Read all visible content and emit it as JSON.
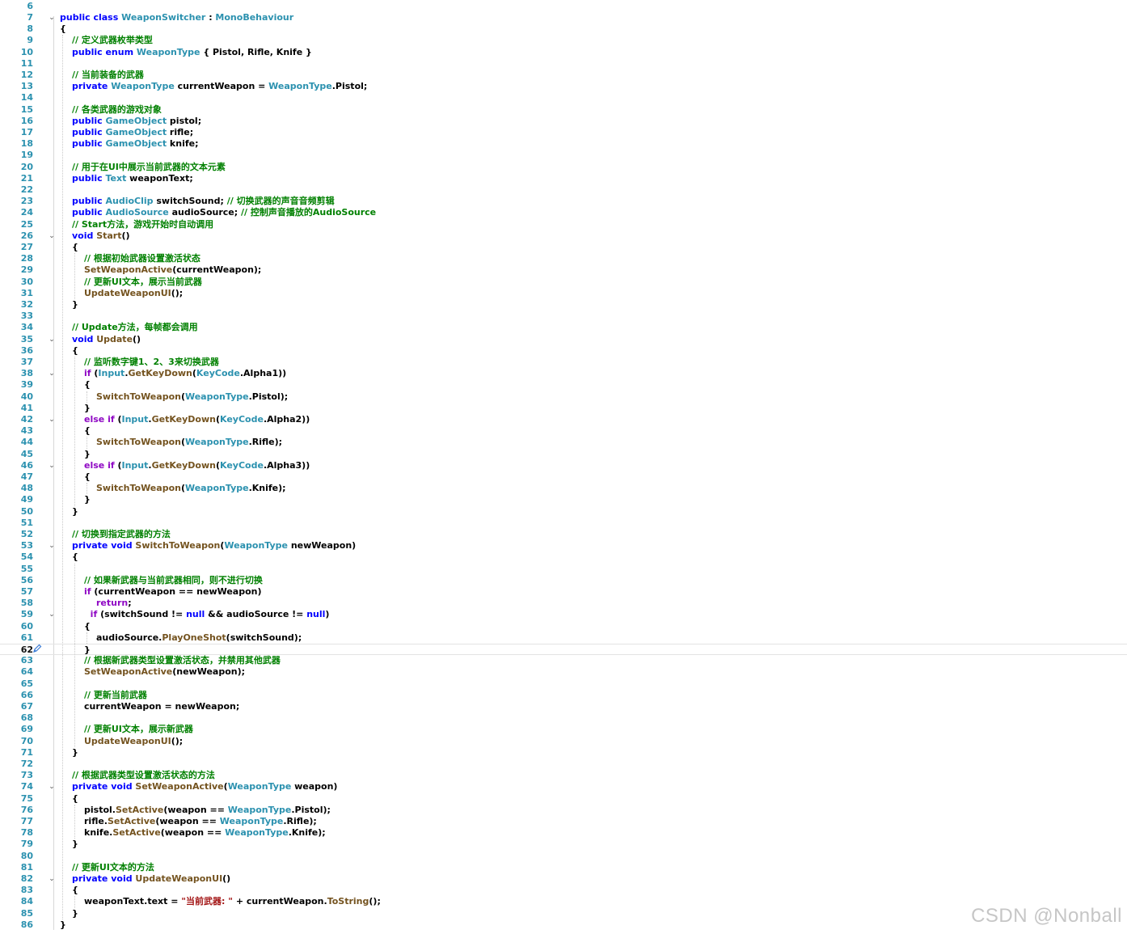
{
  "editor": {
    "first_line_number": 6,
    "current_line_number": 62,
    "lines": [
      {
        "n": 6,
        "tokens": []
      },
      {
        "n": 7,
        "fold": true,
        "tokens": [
          [
            "keyword",
            "public class "
          ],
          [
            "type",
            "WeaponSwitcher"
          ],
          [
            "plain",
            " : "
          ],
          [
            "type",
            "MonoBehaviour"
          ]
        ]
      },
      {
        "n": 8,
        "tokens": [
          [
            "plain",
            "{"
          ]
        ]
      },
      {
        "n": 9,
        "indent": 1,
        "tokens": [
          [
            "comment",
            "// 定义武器枚举类型"
          ]
        ]
      },
      {
        "n": 10,
        "indent": 1,
        "tokens": [
          [
            "keyword",
            "public enum "
          ],
          [
            "type",
            "WeaponType"
          ],
          [
            "plain",
            " { Pistol, Rifle, Knife }"
          ]
        ]
      },
      {
        "n": 11,
        "tokens": []
      },
      {
        "n": 12,
        "indent": 1,
        "tokens": [
          [
            "comment",
            "// 当前装备的武器"
          ]
        ]
      },
      {
        "n": 13,
        "indent": 1,
        "tokens": [
          [
            "keyword",
            "private "
          ],
          [
            "type",
            "WeaponType"
          ],
          [
            "plain",
            " currentWeapon = "
          ],
          [
            "type",
            "WeaponType"
          ],
          [
            "plain",
            ".Pistol;"
          ]
        ]
      },
      {
        "n": 14,
        "tokens": []
      },
      {
        "n": 15,
        "indent": 1,
        "tokens": [
          [
            "comment",
            "// 各类武器的游戏对象"
          ]
        ]
      },
      {
        "n": 16,
        "indent": 1,
        "tokens": [
          [
            "keyword",
            "public "
          ],
          [
            "type",
            "GameObject"
          ],
          [
            "plain",
            " pistol;"
          ]
        ]
      },
      {
        "n": 17,
        "indent": 1,
        "tokens": [
          [
            "keyword",
            "public "
          ],
          [
            "type",
            "GameObject"
          ],
          [
            "plain",
            " rifle;"
          ]
        ]
      },
      {
        "n": 18,
        "indent": 1,
        "tokens": [
          [
            "keyword",
            "public "
          ],
          [
            "type",
            "GameObject"
          ],
          [
            "plain",
            " knife;"
          ]
        ]
      },
      {
        "n": 19,
        "tokens": []
      },
      {
        "n": 20,
        "indent": 1,
        "tokens": [
          [
            "comment",
            "// 用于在UI中展示当前武器的文本元素"
          ]
        ]
      },
      {
        "n": 21,
        "indent": 1,
        "tokens": [
          [
            "keyword",
            "public "
          ],
          [
            "type",
            "Text"
          ],
          [
            "plain",
            " weaponText;"
          ]
        ]
      },
      {
        "n": 22,
        "tokens": []
      },
      {
        "n": 23,
        "indent": 1,
        "tokens": [
          [
            "keyword",
            "public "
          ],
          [
            "type",
            "AudioClip"
          ],
          [
            "plain",
            " switchSound; "
          ],
          [
            "comment",
            "// 切换武器的声音音频剪辑"
          ]
        ]
      },
      {
        "n": 24,
        "indent": 1,
        "tokens": [
          [
            "keyword",
            "public "
          ],
          [
            "type",
            "AudioSource"
          ],
          [
            "plain",
            " audioSource; "
          ],
          [
            "comment",
            "// 控制声音播放的AudioSource"
          ]
        ]
      },
      {
        "n": 25,
        "indent": 1,
        "tokens": [
          [
            "comment",
            "// Start方法，游戏开始时自动调用"
          ]
        ]
      },
      {
        "n": 26,
        "indent": 1,
        "fold": true,
        "tokens": [
          [
            "keyword",
            "void "
          ],
          [
            "method",
            "Start"
          ],
          [
            "plain",
            "()"
          ]
        ]
      },
      {
        "n": 27,
        "indent": 1,
        "tokens": [
          [
            "plain",
            "{"
          ]
        ]
      },
      {
        "n": 28,
        "indent": 2,
        "tokens": [
          [
            "comment",
            "// 根据初始武器设置激活状态"
          ]
        ]
      },
      {
        "n": 29,
        "indent": 2,
        "tokens": [
          [
            "method",
            "SetWeaponActive"
          ],
          [
            "plain",
            "(currentWeapon);"
          ]
        ]
      },
      {
        "n": 30,
        "indent": 2,
        "tokens": [
          [
            "comment",
            "// 更新UI文本，展示当前武器"
          ]
        ]
      },
      {
        "n": 31,
        "indent": 2,
        "tokens": [
          [
            "method",
            "UpdateWeaponUI"
          ],
          [
            "plain",
            "();"
          ]
        ]
      },
      {
        "n": 32,
        "indent": 1,
        "tokens": [
          [
            "plain",
            "}"
          ]
        ]
      },
      {
        "n": 33,
        "tokens": []
      },
      {
        "n": 34,
        "indent": 1,
        "tokens": [
          [
            "comment",
            "// Update方法，每帧都会调用"
          ]
        ]
      },
      {
        "n": 35,
        "indent": 1,
        "fold": true,
        "tokens": [
          [
            "keyword",
            "void "
          ],
          [
            "method",
            "Update"
          ],
          [
            "plain",
            "()"
          ]
        ]
      },
      {
        "n": 36,
        "indent": 1,
        "tokens": [
          [
            "plain",
            "{"
          ]
        ]
      },
      {
        "n": 37,
        "indent": 2,
        "tokens": [
          [
            "comment",
            "// 监听数字键1、2、3来切换武器"
          ]
        ]
      },
      {
        "n": 38,
        "indent": 2,
        "fold": true,
        "tokens": [
          [
            "control",
            "if "
          ],
          [
            "plain",
            "("
          ],
          [
            "type",
            "Input"
          ],
          [
            "plain",
            "."
          ],
          [
            "method",
            "GetKeyDown"
          ],
          [
            "plain",
            "("
          ],
          [
            "type",
            "KeyCode"
          ],
          [
            "plain",
            ".Alpha1))"
          ]
        ]
      },
      {
        "n": 39,
        "indent": 2,
        "tokens": [
          [
            "plain",
            "{"
          ]
        ]
      },
      {
        "n": 40,
        "indent": 3,
        "tokens": [
          [
            "method",
            "SwitchToWeapon"
          ],
          [
            "plain",
            "("
          ],
          [
            "type",
            "WeaponType"
          ],
          [
            "plain",
            ".Pistol);"
          ]
        ]
      },
      {
        "n": 41,
        "indent": 2,
        "tokens": [
          [
            "plain",
            "}"
          ]
        ]
      },
      {
        "n": 42,
        "indent": 2,
        "fold": true,
        "tokens": [
          [
            "control",
            "else if "
          ],
          [
            "plain",
            "("
          ],
          [
            "type",
            "Input"
          ],
          [
            "plain",
            "."
          ],
          [
            "method",
            "GetKeyDown"
          ],
          [
            "plain",
            "("
          ],
          [
            "type",
            "KeyCode"
          ],
          [
            "plain",
            ".Alpha2))"
          ]
        ]
      },
      {
        "n": 43,
        "indent": 2,
        "tokens": [
          [
            "plain",
            "{"
          ]
        ]
      },
      {
        "n": 44,
        "indent": 3,
        "tokens": [
          [
            "method",
            "SwitchToWeapon"
          ],
          [
            "plain",
            "("
          ],
          [
            "type",
            "WeaponType"
          ],
          [
            "plain",
            ".Rifle);"
          ]
        ]
      },
      {
        "n": 45,
        "indent": 2,
        "tokens": [
          [
            "plain",
            "}"
          ]
        ]
      },
      {
        "n": 46,
        "indent": 2,
        "fold": true,
        "tokens": [
          [
            "control",
            "else if "
          ],
          [
            "plain",
            "("
          ],
          [
            "type",
            "Input"
          ],
          [
            "plain",
            "."
          ],
          [
            "method",
            "GetKeyDown"
          ],
          [
            "plain",
            "("
          ],
          [
            "type",
            "KeyCode"
          ],
          [
            "plain",
            ".Alpha3))"
          ]
        ]
      },
      {
        "n": 47,
        "indent": 2,
        "tokens": [
          [
            "plain",
            "{"
          ]
        ]
      },
      {
        "n": 48,
        "indent": 3,
        "tokens": [
          [
            "method",
            "SwitchToWeapon"
          ],
          [
            "plain",
            "("
          ],
          [
            "type",
            "WeaponType"
          ],
          [
            "plain",
            ".Knife);"
          ]
        ]
      },
      {
        "n": 49,
        "indent": 2,
        "tokens": [
          [
            "plain",
            "}"
          ]
        ]
      },
      {
        "n": 50,
        "indent": 1,
        "tokens": [
          [
            "plain",
            "}"
          ]
        ]
      },
      {
        "n": 51,
        "tokens": []
      },
      {
        "n": 52,
        "indent": 1,
        "tokens": [
          [
            "comment",
            "// 切换到指定武器的方法"
          ]
        ]
      },
      {
        "n": 53,
        "indent": 1,
        "fold": true,
        "tokens": [
          [
            "keyword",
            "private void "
          ],
          [
            "method",
            "SwitchToWeapon"
          ],
          [
            "plain",
            "("
          ],
          [
            "type",
            "WeaponType"
          ],
          [
            "plain",
            " newWeapon)"
          ]
        ]
      },
      {
        "n": 54,
        "indent": 1,
        "tokens": [
          [
            "plain",
            "{"
          ]
        ]
      },
      {
        "n": 55,
        "tokens": []
      },
      {
        "n": 56,
        "indent": 2,
        "tokens": [
          [
            "comment",
            "// 如果新武器与当前武器相同，则不进行切换"
          ]
        ]
      },
      {
        "n": 57,
        "indent": 2,
        "tokens": [
          [
            "control",
            "if "
          ],
          [
            "plain",
            "(currentWeapon == newWeapon)"
          ]
        ]
      },
      {
        "n": 58,
        "indent": 3,
        "tokens": [
          [
            "control",
            "return"
          ],
          [
            "plain",
            ";"
          ]
        ]
      },
      {
        "n": 59,
        "indent": 2,
        "lead": "  ",
        "fold": true,
        "tokens": [
          [
            "control",
            "if "
          ],
          [
            "plain",
            "(switchSound != "
          ],
          [
            "keyword",
            "null"
          ],
          [
            "plain",
            " && audioSource != "
          ],
          [
            "keyword",
            "null"
          ],
          [
            "plain",
            ")"
          ]
        ]
      },
      {
        "n": 60,
        "indent": 2,
        "tokens": [
          [
            "plain",
            "{"
          ]
        ]
      },
      {
        "n": 61,
        "indent": 3,
        "tokens": [
          [
            "plain",
            "audioSource."
          ],
          [
            "method",
            "PlayOneShot"
          ],
          [
            "plain",
            "(switchSound);"
          ]
        ]
      },
      {
        "n": 62,
        "indent": 2,
        "tokens": [
          [
            "plain",
            "}"
          ]
        ]
      },
      {
        "n": 63,
        "indent": 2,
        "tokens": [
          [
            "comment",
            "// 根据新武器类型设置激活状态，并禁用其他武器"
          ]
        ]
      },
      {
        "n": 64,
        "indent": 2,
        "tokens": [
          [
            "method",
            "SetWeaponActive"
          ],
          [
            "plain",
            "(newWeapon);"
          ]
        ]
      },
      {
        "n": 65,
        "tokens": []
      },
      {
        "n": 66,
        "indent": 2,
        "tokens": [
          [
            "comment",
            "// 更新当前武器"
          ]
        ]
      },
      {
        "n": 67,
        "indent": 2,
        "tokens": [
          [
            "plain",
            "currentWeapon = newWeapon;"
          ]
        ]
      },
      {
        "n": 68,
        "tokens": []
      },
      {
        "n": 69,
        "indent": 2,
        "tokens": [
          [
            "comment",
            "// 更新UI文本，展示新武器"
          ]
        ]
      },
      {
        "n": 70,
        "indent": 2,
        "tokens": [
          [
            "method",
            "UpdateWeaponUI"
          ],
          [
            "plain",
            "();"
          ]
        ]
      },
      {
        "n": 71,
        "indent": 1,
        "tokens": [
          [
            "plain",
            "}"
          ]
        ]
      },
      {
        "n": 72,
        "tokens": []
      },
      {
        "n": 73,
        "indent": 1,
        "tokens": [
          [
            "comment",
            "// 根据武器类型设置激活状态的方法"
          ]
        ]
      },
      {
        "n": 74,
        "indent": 1,
        "fold": true,
        "tokens": [
          [
            "keyword",
            "private void "
          ],
          [
            "method",
            "SetWeaponActive"
          ],
          [
            "plain",
            "("
          ],
          [
            "type",
            "WeaponType"
          ],
          [
            "plain",
            " weapon)"
          ]
        ]
      },
      {
        "n": 75,
        "indent": 1,
        "tokens": [
          [
            "plain",
            "{"
          ]
        ]
      },
      {
        "n": 76,
        "indent": 2,
        "tokens": [
          [
            "plain",
            "pistol."
          ],
          [
            "method",
            "SetActive"
          ],
          [
            "plain",
            "(weapon == "
          ],
          [
            "type",
            "WeaponType"
          ],
          [
            "plain",
            ".Pistol);"
          ]
        ]
      },
      {
        "n": 77,
        "indent": 2,
        "tokens": [
          [
            "plain",
            "rifle."
          ],
          [
            "method",
            "SetActive"
          ],
          [
            "plain",
            "(weapon == "
          ],
          [
            "type",
            "WeaponType"
          ],
          [
            "plain",
            ".Rifle);"
          ]
        ]
      },
      {
        "n": 78,
        "indent": 2,
        "tokens": [
          [
            "plain",
            "knife."
          ],
          [
            "method",
            "SetActive"
          ],
          [
            "plain",
            "(weapon == "
          ],
          [
            "type",
            "WeaponType"
          ],
          [
            "plain",
            ".Knife);"
          ]
        ]
      },
      {
        "n": 79,
        "indent": 1,
        "tokens": [
          [
            "plain",
            "}"
          ]
        ]
      },
      {
        "n": 80,
        "tokens": []
      },
      {
        "n": 81,
        "indent": 1,
        "tokens": [
          [
            "comment",
            "// 更新UI文本的方法"
          ]
        ]
      },
      {
        "n": 82,
        "indent": 1,
        "fold": true,
        "tokens": [
          [
            "keyword",
            "private void "
          ],
          [
            "method",
            "UpdateWeaponUI"
          ],
          [
            "plain",
            "()"
          ]
        ]
      },
      {
        "n": 83,
        "indent": 1,
        "tokens": [
          [
            "plain",
            "{"
          ]
        ]
      },
      {
        "n": 84,
        "indent": 2,
        "tokens": [
          [
            "plain",
            "weaponText.text = "
          ],
          [
            "string",
            "\"当前武器: \""
          ],
          [
            "plain",
            " + currentWeapon."
          ],
          [
            "method",
            "ToString"
          ],
          [
            "plain",
            "();"
          ]
        ]
      },
      {
        "n": 85,
        "indent": 1,
        "tokens": [
          [
            "plain",
            "}"
          ]
        ]
      },
      {
        "n": 86,
        "tokens": [
          [
            "plain",
            "}"
          ]
        ]
      }
    ]
  },
  "icons": {
    "fold_glyph": "⌄",
    "edit_icon": "pencil-icon"
  },
  "colors": {
    "keyword": "#0000ff",
    "type": "#2b91af",
    "method": "#74531f",
    "comment": "#008000",
    "string": "#a31515",
    "control": "#8f08c4",
    "line_number": "#2b91af"
  },
  "watermark": "CSDN @Nonball"
}
